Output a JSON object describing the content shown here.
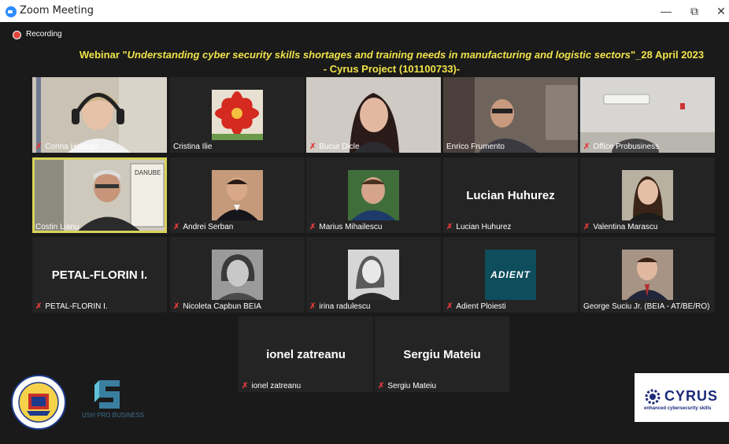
{
  "window": {
    "title": "Zoom Meeting",
    "minimize": "—",
    "maximize": "⧉",
    "close": "✕"
  },
  "recording": {
    "label": "Recording",
    "color": "#e0453a"
  },
  "webinar": {
    "prefix": "Webinar \"",
    "italic": "Understanding cyber security skills shortages and training needs in manufacturing and logistic sectors",
    "suffix": "\"_28 April 2023",
    "line2": "- Cyrus Project (101100733)-"
  },
  "participants": [
    {
      "name": "Corina Holerga",
      "muted": true
    },
    {
      "name": "Cristina Ilie",
      "muted": false
    },
    {
      "name": "Bucur Dicle",
      "muted": true
    },
    {
      "name": "Enrico Frumento",
      "muted": false
    },
    {
      "name": "Office Probusiness",
      "muted": true
    },
    {
      "name": "Costin Lianu",
      "muted": false,
      "active": true
    },
    {
      "name": "Andrei Serban",
      "muted": true
    },
    {
      "name": "Marius Mihailescu",
      "muted": true
    },
    {
      "name": "Lucian Huhurez",
      "muted": true,
      "display": "Lucian Huhurez"
    },
    {
      "name": "Valentina Marascu",
      "muted": true
    },
    {
      "name": "PETAL-FLORIN I.",
      "muted": true,
      "display": "PETAL-FLORIN I."
    },
    {
      "name": "Nicoleta Capbun  BEIA",
      "muted": true
    },
    {
      "name": "irina radulescu",
      "muted": true
    },
    {
      "name": "Adient Ploiesti",
      "muted": true,
      "logo": "ADIENT"
    },
    {
      "name": "George Suciu Jr. (BEIA - AT/BE/RO)",
      "muted": false
    },
    {
      "name": "ionel zatreanu",
      "muted": true,
      "display": "ionel zatreanu"
    },
    {
      "name": "Sergiu Mateiu",
      "muted": true,
      "display": "Sergiu Mateiu"
    }
  ],
  "branding": {
    "left_logo_text": "USH PRO BUSINESS",
    "cyrus_title": "CYRUS",
    "cyrus_sub": "enhanced cybersecurity skills"
  },
  "colors": {
    "accent": "#d8d35a",
    "title": "#f0e34a",
    "muted_icon": "#e23b3b"
  }
}
